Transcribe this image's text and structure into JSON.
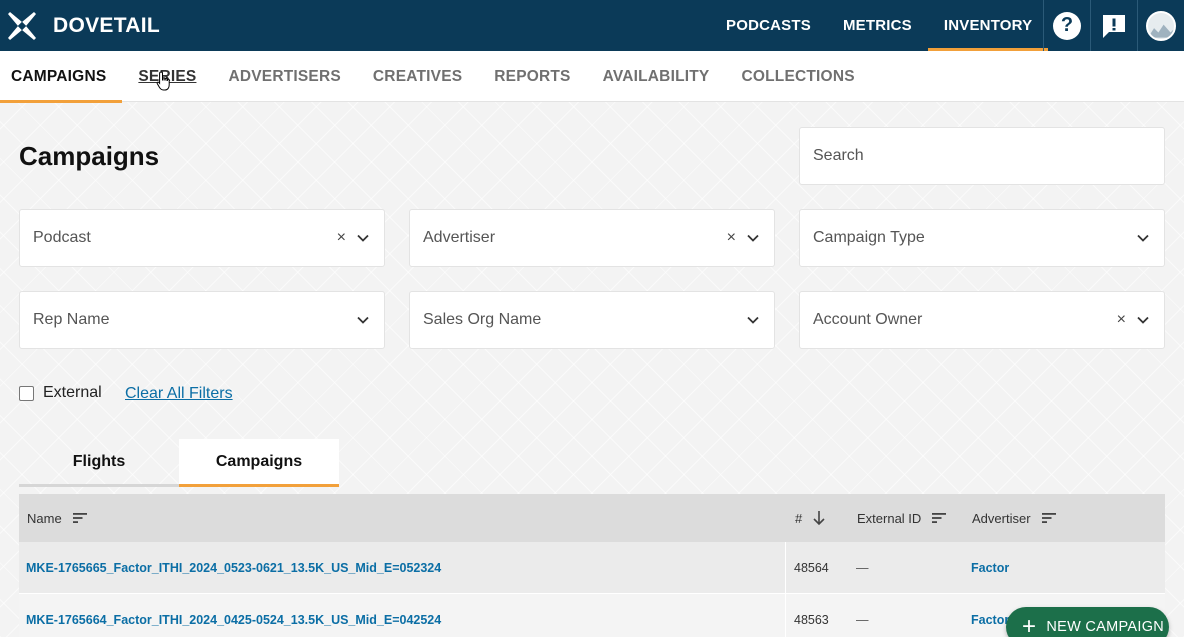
{
  "brand": {
    "name": "DOVETAIL",
    "accent": "#f2a03a",
    "topbar_color": "#0b3a58",
    "link_color": "#0b6ea5"
  },
  "topnav": {
    "items": [
      {
        "label": "PODCASTS",
        "active": false
      },
      {
        "label": "METRICS",
        "active": false
      },
      {
        "label": "INVENTORY",
        "active": true
      }
    ],
    "icons": [
      "help-icon",
      "feedback-icon",
      "avatar"
    ]
  },
  "subnav": {
    "items": [
      {
        "label": "CAMPAIGNS",
        "active": true
      },
      {
        "label": "SERIES",
        "active": false,
        "hover": true
      },
      {
        "label": "ADVERTISERS",
        "active": false
      },
      {
        "label": "CREATIVES",
        "active": false
      },
      {
        "label": "REPORTS",
        "active": false
      },
      {
        "label": "AVAILABILITY",
        "active": false
      },
      {
        "label": "COLLECTIONS",
        "active": false
      }
    ]
  },
  "page": {
    "title": "Campaigns",
    "search_placeholder": "Search"
  },
  "filters": {
    "podcast": "Podcast",
    "advertiser": "Advertiser",
    "campaign_type": "Campaign Type",
    "rep_name": "Rep Name",
    "sales_org_name": "Sales Org Name",
    "account_owner": "Account Owner",
    "clear_symbol": "×"
  },
  "external": {
    "label": "External",
    "checked": false
  },
  "clear_all": "Clear All Filters",
  "tabs": [
    {
      "label": "Flights",
      "active": false
    },
    {
      "label": "Campaigns",
      "active": true
    }
  ],
  "table": {
    "columns": {
      "name": "Name",
      "num": "#",
      "external_id": "External ID",
      "advertiser": "Advertiser"
    },
    "rows": [
      {
        "name": "MKE-1765665_Factor_ITHI_2024_0523-0621_13.5K_US_Mid_E=052324",
        "num": "48564",
        "external_id": "—",
        "advertiser": "Factor"
      },
      {
        "name": "MKE-1765664_Factor_ITHI_2024_0425-0524_13.5K_US_Mid_E=042524",
        "num": "48563",
        "external_id": "—",
        "advertiser": "Factor"
      }
    ]
  },
  "fab": {
    "label": "NEW CAMPAIGN",
    "icon": "plus-icon"
  }
}
